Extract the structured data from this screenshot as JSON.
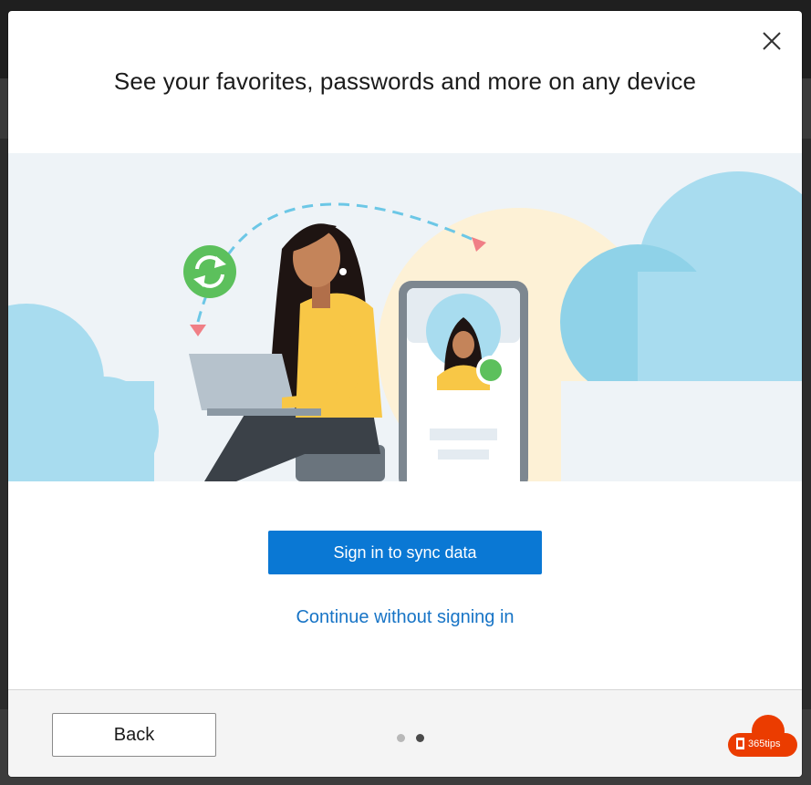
{
  "dialog": {
    "title": "See your favorites, passwords and more on any device",
    "primary_button": "Sign in to sync data",
    "secondary_link": "Continue without signing in",
    "back_button": "Back",
    "pagination": {
      "total": 2,
      "current": 2
    }
  },
  "colors": {
    "primary": "#0a78d4",
    "link": "#1774c6",
    "sync_green": "#5cc05c",
    "cloud": "#a8dcef",
    "watermark": "#eb3c00"
  },
  "watermark": {
    "text": "365tips"
  },
  "icons": [
    "close-icon",
    "sync-icon",
    "office-logo-icon"
  ]
}
